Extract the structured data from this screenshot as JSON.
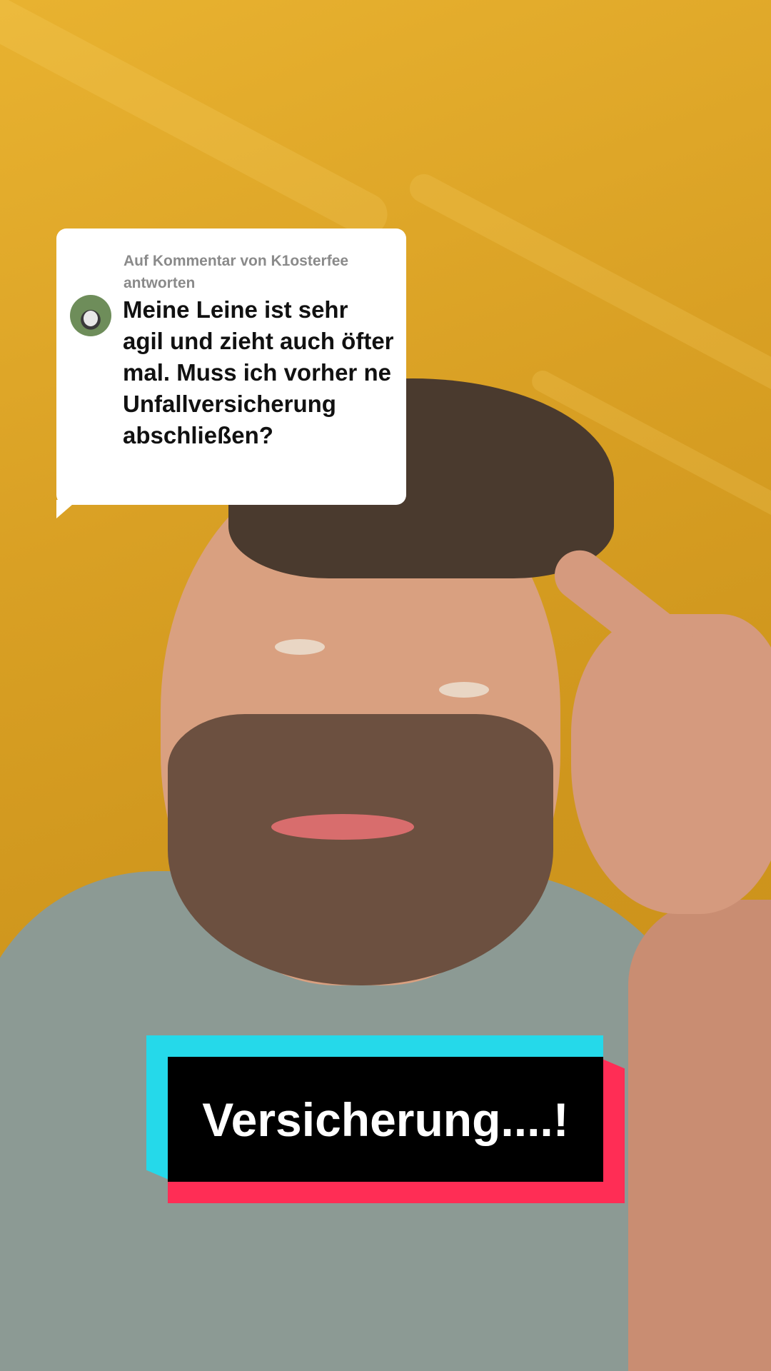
{
  "reply": {
    "header": "Auf Kommentar von K1osterfee antworten",
    "comment": "Meine Leine ist sehr agil und zieht auch öfter mal. Muss ich vorher ne Unfallversicherung abschließen?"
  },
  "caption": {
    "text": "Versicherung....!"
  },
  "colors": {
    "background": "#d9a024",
    "bubble": "#ffffff",
    "caption_cyan": "#25d9ea",
    "caption_red": "#ff2d55",
    "caption_black": "#000000"
  }
}
